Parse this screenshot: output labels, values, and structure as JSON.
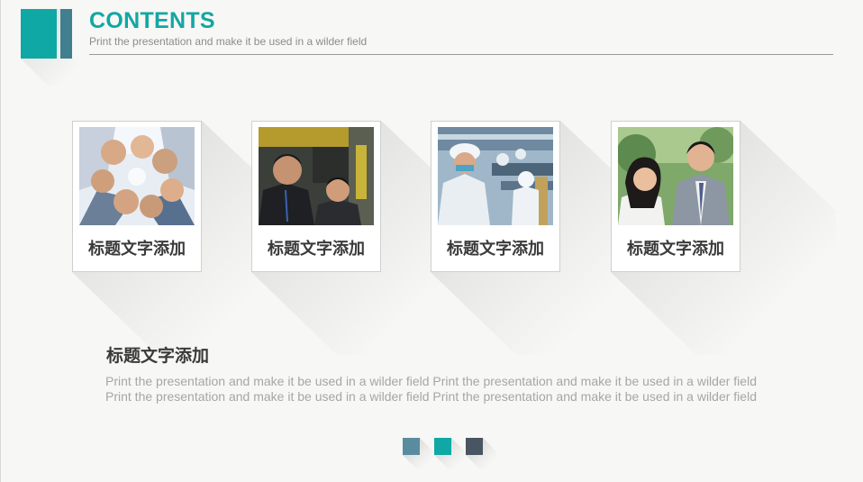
{
  "header": {
    "title": "CONTENTS",
    "subtitle": "Print the presentation and make it be used in a wilder field"
  },
  "cards": [
    {
      "title": "标题文字添加",
      "photo": "people-huddle-looking-down-photo"
    },
    {
      "title": "标题文字添加",
      "photo": "two-businessmen-photo"
    },
    {
      "title": "标题文字添加",
      "photo": "factory-workers-photo"
    },
    {
      "title": "标题文字添加",
      "photo": "business-couple-photo"
    }
  ],
  "section": {
    "heading": "标题文字添加",
    "body": "Print the presentation and make it be used in a wilder field Print the presentation and make it be used in a wilder field Print the presentation and make it be used in a wilder field Print the presentation and make it be used in a wilder field"
  },
  "pager": {
    "colors": [
      "#5a8ca0",
      "#0fa8a4",
      "#4a5563"
    ]
  },
  "colors": {
    "accent": "#0fa8a4",
    "accent_dark": "#3f7f8e",
    "background": "#f7f7f5"
  }
}
